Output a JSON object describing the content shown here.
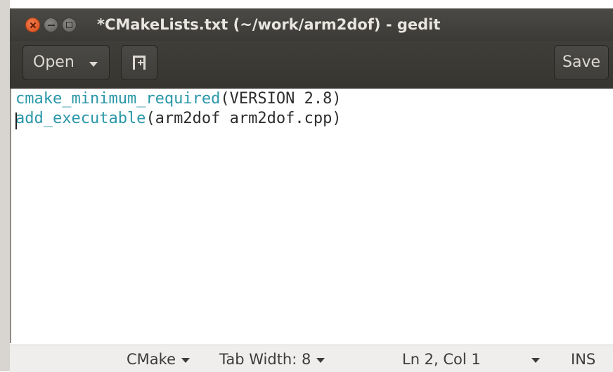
{
  "window": {
    "title": "*CMakeLists.txt (~/work/arm2dof) - gedit"
  },
  "toolbar": {
    "open_label": "Open",
    "new_tab_icon": "new-document-icon",
    "save_label": "Save"
  },
  "editor": {
    "lines": [
      {
        "func": "cmake_minimum_required",
        "args": "(VERSION 2.8)"
      },
      {
        "func": "add_executable",
        "args": "(arm2dof arm2dof.cpp)"
      }
    ],
    "syntax_color": "#2a97a8"
  },
  "statusbar": {
    "language": "CMake",
    "tab_width": "Tab Width: 8",
    "position": "Ln 2, Col 1",
    "mode": "INS"
  }
}
